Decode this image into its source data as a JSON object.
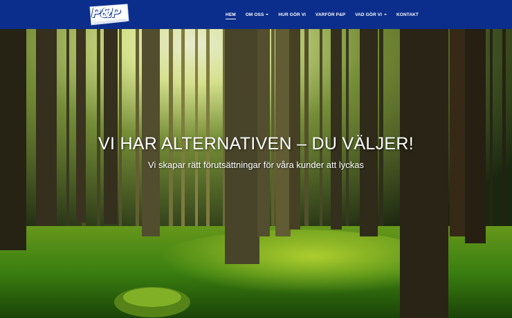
{
  "header": {
    "logo_text": "P&P",
    "colors": {
      "background": "#0b2e8c",
      "text": "#ffffff"
    }
  },
  "nav": {
    "items": [
      {
        "label": "HEM",
        "active": true,
        "dropdown": false
      },
      {
        "label": "OM OSS",
        "active": false,
        "dropdown": true
      },
      {
        "label": "HUR GÖR VI",
        "active": false,
        "dropdown": false
      },
      {
        "label": "VARFÖR P&P",
        "active": false,
        "dropdown": false
      },
      {
        "label": "VAD GÖR VI",
        "active": false,
        "dropdown": true
      },
      {
        "label": "KONTAKT",
        "active": false,
        "dropdown": false
      }
    ]
  },
  "hero": {
    "title": "VI HAR ALTERNATIVEN – DU VÄLJER!",
    "subtitle": "Vi skapar rätt förutsättningar för våra kunder att lyckas",
    "image_subject": "sunlit-forest-photo"
  }
}
